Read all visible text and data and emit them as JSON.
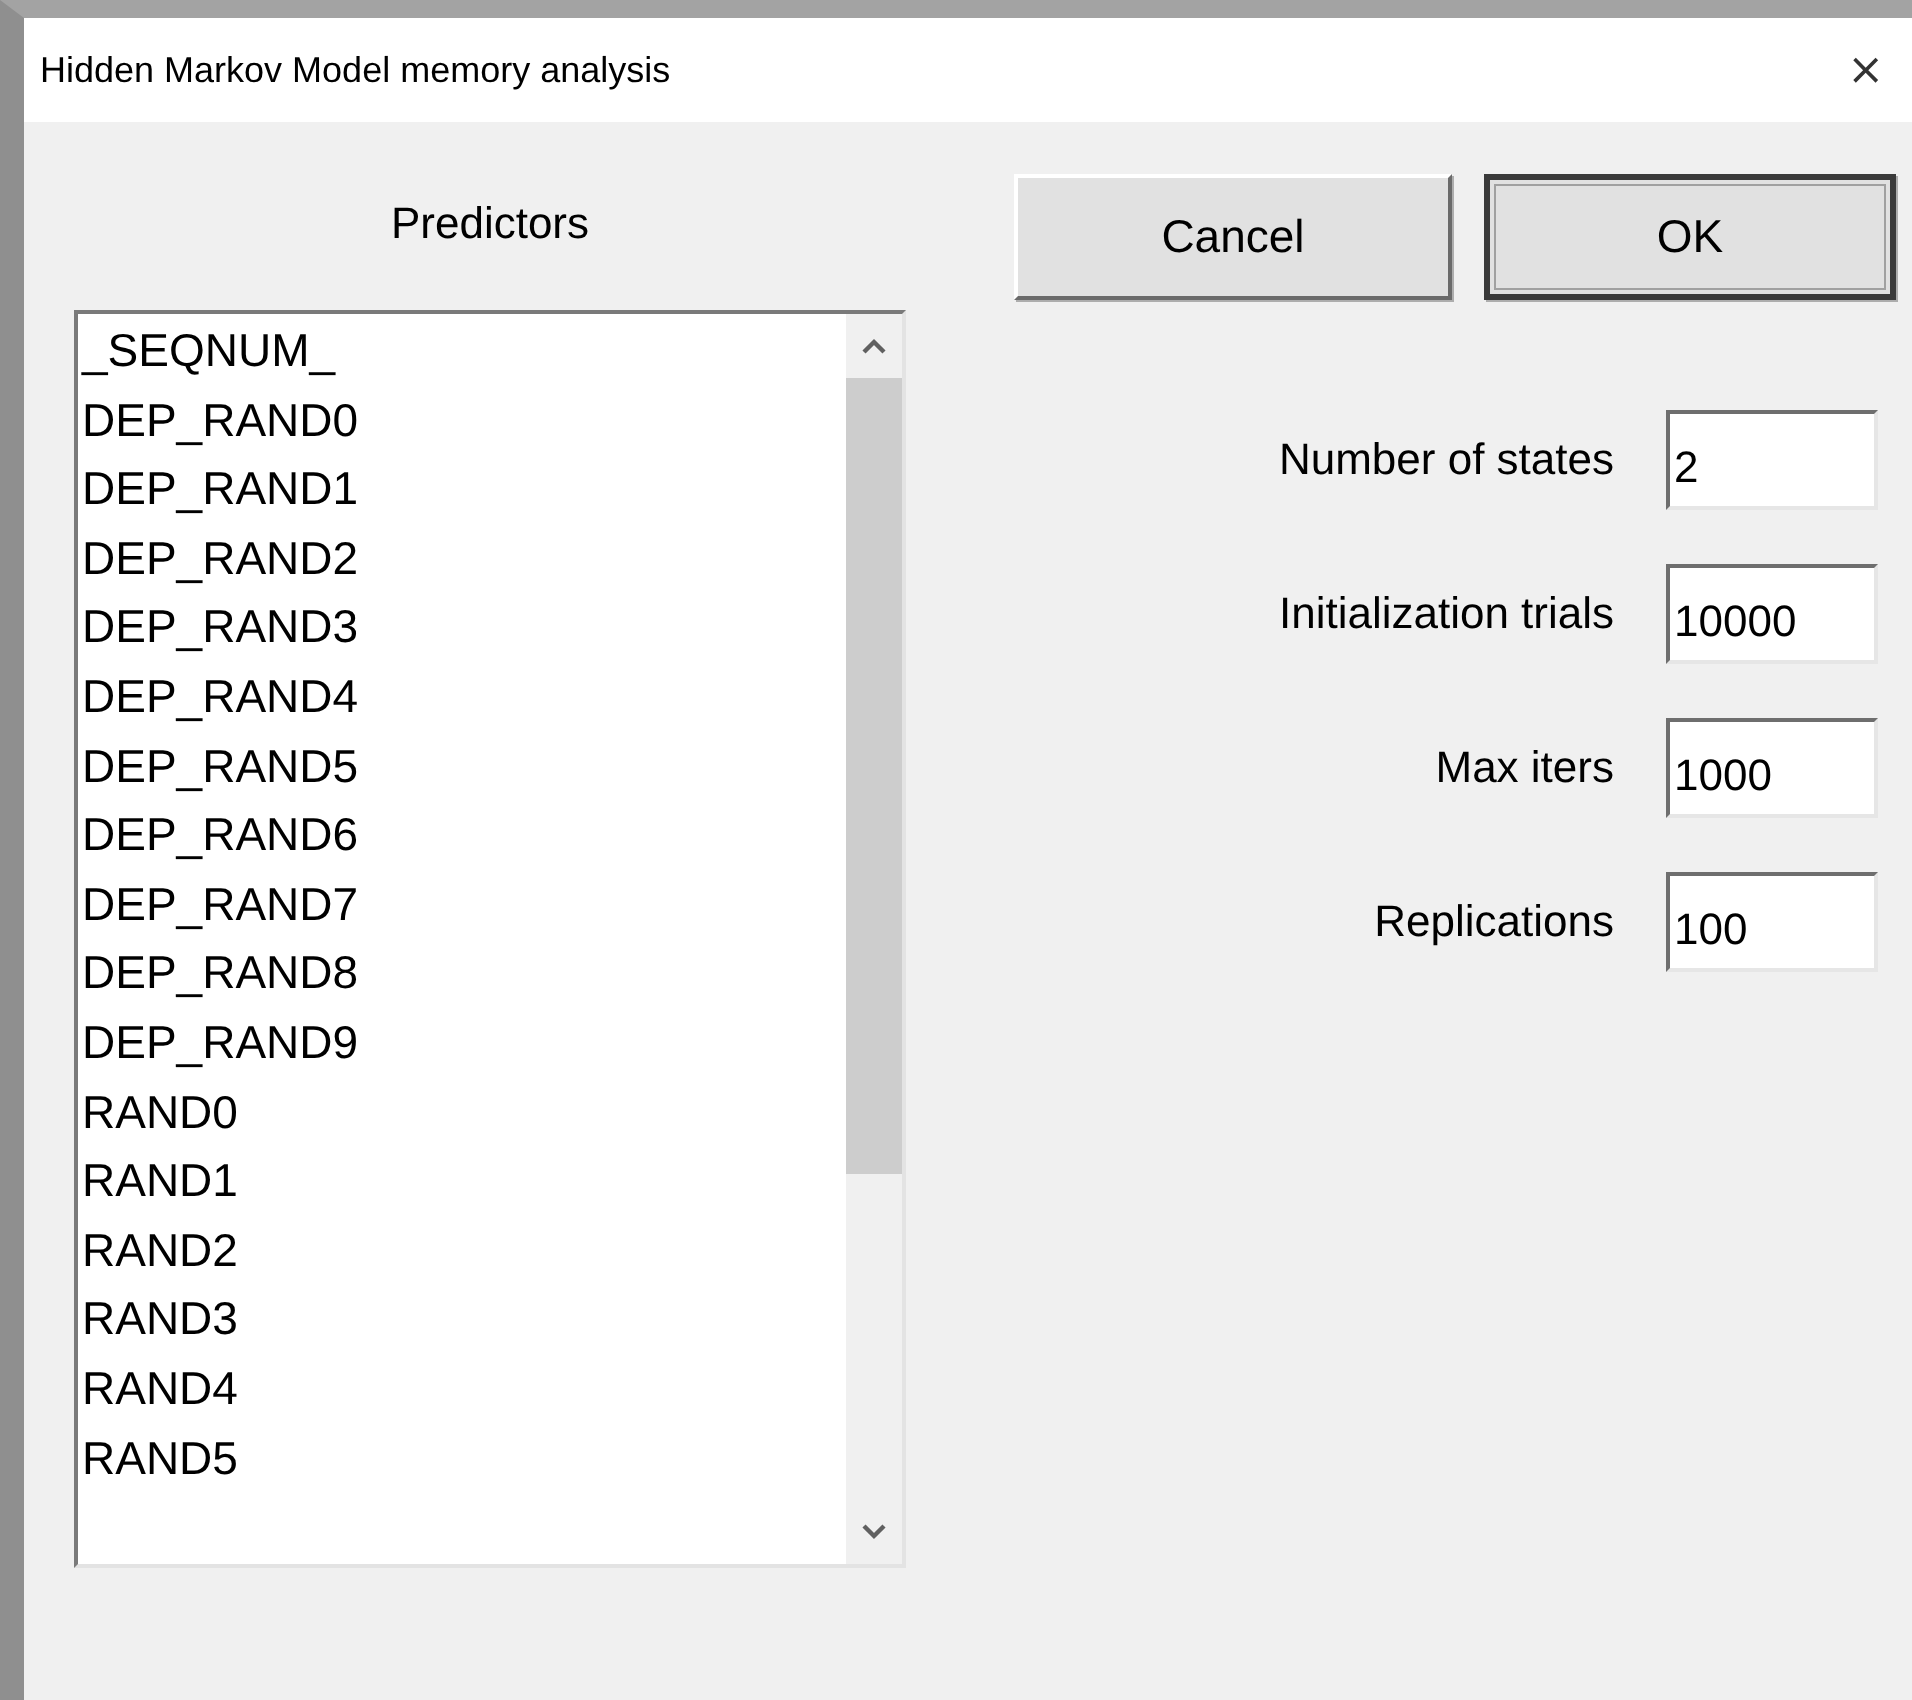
{
  "window": {
    "title": "Hidden Markov Model memory analysis",
    "close": "×"
  },
  "predictors": {
    "label": "Predictors",
    "items": [
      "_SEQNUM_",
      "DEP_RAND0",
      "DEP_RAND1",
      "DEP_RAND2",
      "DEP_RAND3",
      "DEP_RAND4",
      "DEP_RAND5",
      "DEP_RAND6",
      "DEP_RAND7",
      "DEP_RAND8",
      "DEP_RAND9",
      "RAND0",
      "RAND1",
      "RAND2",
      "RAND3",
      "RAND4",
      "RAND5"
    ]
  },
  "buttons": [
    {
      "label": "Cancel",
      "default": false
    },
    {
      "label": "OK",
      "default": true
    }
  ],
  "fields": [
    {
      "label": "Number of states",
      "value": "2"
    },
    {
      "label": "Initialization trials",
      "value": "10000"
    },
    {
      "label": "Max iters",
      "value": "1000"
    },
    {
      "label": "Replications",
      "value": "100"
    }
  ]
}
